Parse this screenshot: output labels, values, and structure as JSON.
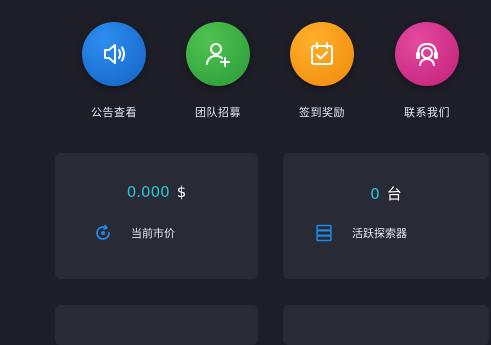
{
  "quick_actions": [
    {
      "label": "公告查看",
      "icon": "speaker-icon",
      "color": "#1f78dc"
    },
    {
      "label": "团队招募",
      "icon": "add-user-icon",
      "color": "#38ae43"
    },
    {
      "label": "签到奖励",
      "icon": "calendar-check-icon",
      "color": "#f89c1c"
    },
    {
      "label": "联系我们",
      "icon": "headset-icon",
      "color": "#d6318c"
    }
  ],
  "stats": [
    {
      "value": "0.000",
      "unit": "$",
      "label": "当前市价",
      "icon": "price-refresh-icon"
    },
    {
      "value": "0",
      "unit": "台",
      "label": "活跃探索器",
      "icon": "server-stack-icon"
    }
  ],
  "colors": {
    "background": "#1d1e27",
    "card": "#282a35",
    "accent": "#27c6d6",
    "icon_accent": "#1f88e5"
  }
}
